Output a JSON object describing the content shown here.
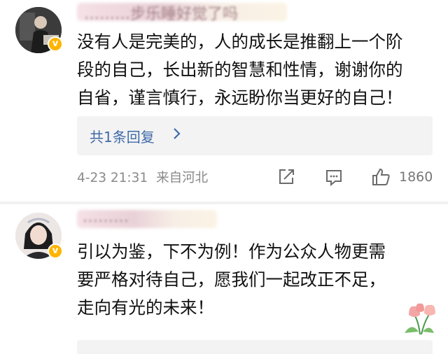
{
  "comments": [
    {
      "username": "………步乐睡好觉了吗",
      "avatar_icon": "user-avatar-dark",
      "badge_icon": "verified-v-badge",
      "lines": [
        "没有人是完美的，人的成长是推翻上一个阶",
        "段的自己，长出新的智慧和性情，谢谢你的",
        "自省，谨言慎行，永远盼你当更好的自己！"
      ],
      "reply_link": "共1条回复",
      "timestamp": "4-23 21:31",
      "location": "来自河北",
      "like_count": "1860"
    },
    {
      "username": "………",
      "avatar_icon": "user-avatar-light",
      "badge_icon": "verified-v-badge",
      "lines": [
        "引以为鉴，下不为例！作为公众人物更需",
        "要严格对待自己，愿我们一起改正不足，",
        "走向有光的未来！"
      ]
    }
  ],
  "colors": {
    "link": "#3f6aa8",
    "badge": "#ffb400",
    "meta": "#8a8a8a"
  }
}
